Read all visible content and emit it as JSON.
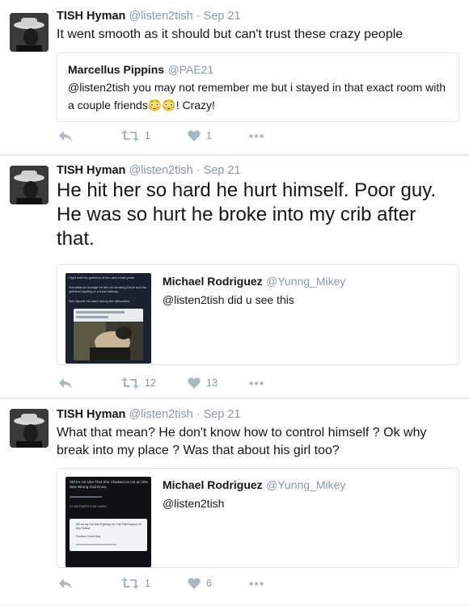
{
  "tweets": [
    {
      "name": "TISH Hyman",
      "handle": "@listen2tish",
      "dot": "·",
      "time": "Sep 21",
      "text": "It went smooth as it should but can't trust these crazy people",
      "quote": {
        "name": "Marcellus Pippins",
        "handle": "@PAE21",
        "text": "@listen2tish you may not remember me but i stayed in that exact room with a couple friends😳😳! Crazy!"
      },
      "retweets": "1",
      "likes": "1"
    },
    {
      "name": "TISH Hyman",
      "handle": "@listen2tish",
      "dot": "·",
      "time": "Sep 21",
      "text": "He hit her so hard he hurt himself. Poor guy. He was so hurt he broke into my crib after that.",
      "quote": {
        "name": "Michael Rodriguez",
        "handle": "@Yunng_Mikey",
        "text": "@listen2tish did u see this",
        "thumb_lines": [
          "Fight with his girlfriend of two and a half years.",
          "Surveillance footage hit the net showing Devin and his girlfriend fighting in a hotel hallway.",
          "Dev injured his hand during the altercation."
        ]
      },
      "retweets": "12",
      "likes": "13"
    },
    {
      "name": "TISH Hyman",
      "handle": "@listen2tish",
      "dot": "·",
      "time": "Sep 21",
      "text": "What that mean? He don't know how to control himself ? Ok why break into my place ? Was that about his girl too?",
      "quote": {
        "name": "Michael Rodriguez",
        "handle": "@Yunng_Mikey",
        "text": "@listen2tish",
        "thumb_lines": [
          "Wtf Im not Like That She Cheated on me an She Was Wrong God Know",
          "21 RETWEETS   63 LIKES",
          "Me an my Girl was Fighting On Y'all Shit Happen I'm Not Perfect",
          "Problem Gone Now"
        ]
      },
      "retweets": "1",
      "likes": "6"
    }
  ],
  "icons": {
    "reply": "reply-icon",
    "retweet": "retweet-icon",
    "like": "heart-icon",
    "more": "more-icon"
  },
  "colors": {
    "action_gray": "#aab8c2",
    "meta_gray": "#8899a6",
    "border": "#e1e8ed"
  }
}
